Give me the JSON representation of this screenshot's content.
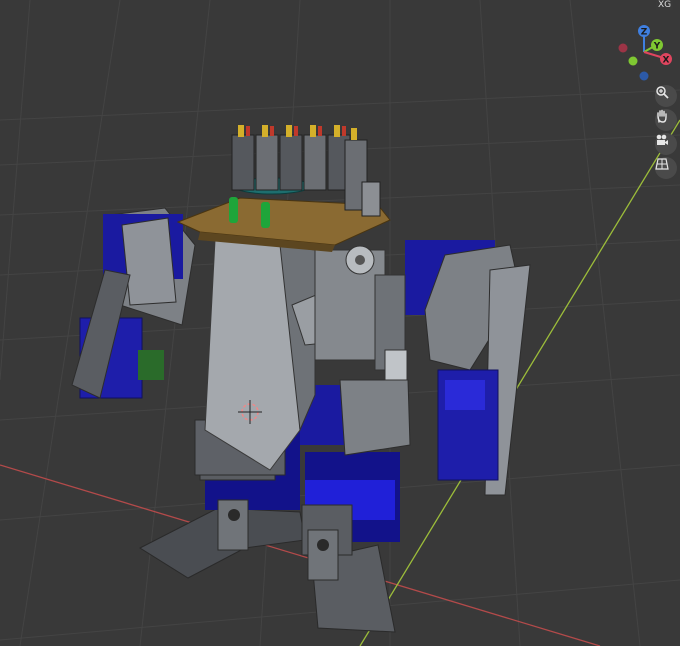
{
  "viewport": {
    "background": "#393939",
    "grid_color": "#424242",
    "x_axis_color": "#b34a4a",
    "y_axis_color": "#9cbd3a"
  },
  "gizmo": {
    "z_label": "Z",
    "y_label": "Y",
    "x_label": "X",
    "z_color": "#3f7fe0",
    "y_color": "#7fc832",
    "x_color": "#e0455f"
  },
  "corner_tag": "XG",
  "nav_icons": [
    "zoom-icon",
    "hand-pan-icon",
    "camera-icon",
    "grid-view-icon"
  ]
}
